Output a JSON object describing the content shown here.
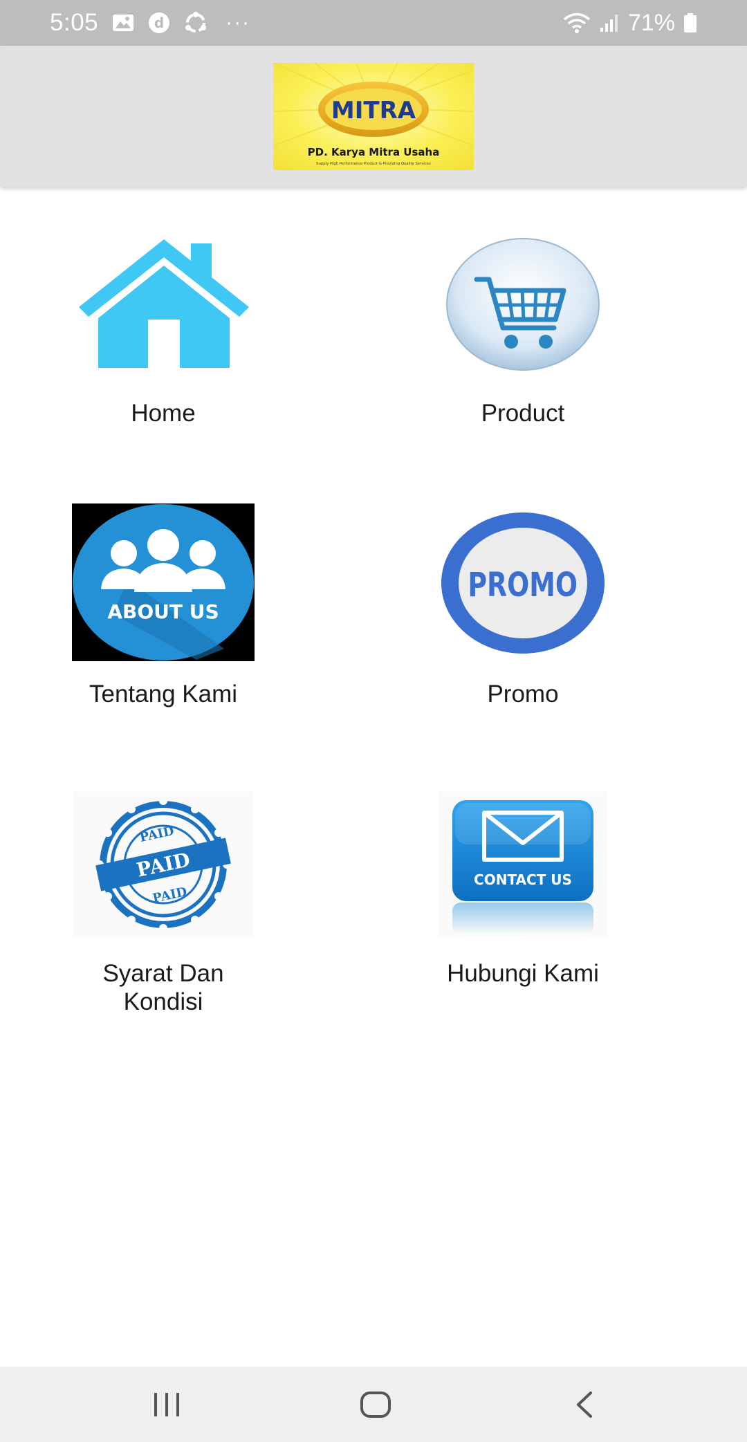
{
  "status_bar": {
    "time": "5:05",
    "battery": "71%",
    "icons": [
      "gallery-icon",
      "d-app-icon",
      "sync-icon",
      "more-dots-icon",
      "wifi-icon",
      "signal-icon",
      "battery-icon"
    ],
    "more": "···"
  },
  "header": {
    "logo": {
      "brand": "MITRA",
      "company": "PD. Karya Mitra Usaha",
      "tagline": "Supply High Performance Product & Providing Quality Services"
    }
  },
  "menu": {
    "home_label": "Home",
    "product_label": "Product",
    "about_label": "Tentang Kami",
    "about_icon_text": "ABOUT US",
    "promo_label": "Promo",
    "promo_icon_text": "PROMO",
    "terms_label": "Syarat Dan\nKondisi",
    "terms_icon_text": "PAID",
    "contact_label": "Hubungi Kami",
    "contact_icon_text": "CONTACT US"
  },
  "nav_bar": {
    "buttons": [
      "recent-apps-icon",
      "home-nav-icon",
      "back-icon"
    ]
  },
  "colors": {
    "status_bar": "#bdbdbd",
    "header": "#e2e2e2",
    "home_blue": "#3fc8f4",
    "about_blue": "#2491d6",
    "promo_blue": "#3a6fd0",
    "contact_blue": "#1a8ad8",
    "logo_yellow": "#f8ec45"
  }
}
